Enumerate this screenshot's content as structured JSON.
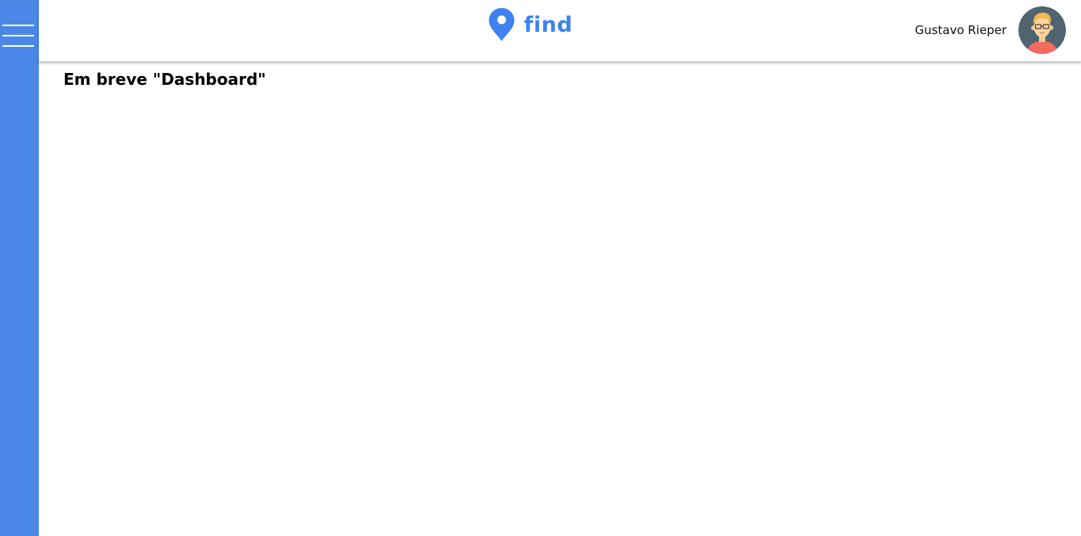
{
  "app": {
    "logo_text": "find",
    "logo_icon": "map-pin-icon",
    "brand_color": "#3d82f0",
    "sidebar_color": "#4a87e8"
  },
  "sidebar": {
    "menu_icon": "hamburger-menu-icon"
  },
  "header": {
    "user_name": "Gustavo Rieper",
    "avatar_icon": "user-avatar"
  },
  "main": {
    "title": "Em breve \"Dashboard\""
  }
}
